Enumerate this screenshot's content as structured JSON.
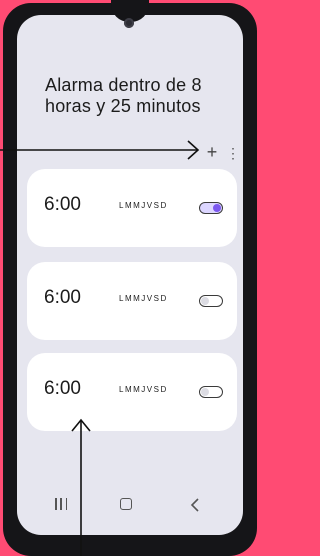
{
  "header": {
    "title": "Alarma dentro de 8 horas y 25 minutos"
  },
  "toolbar": {
    "add_icon": "plus-icon",
    "more_icon": "more-vert-icon",
    "add_glyph": "+",
    "more_glyph": "⋮"
  },
  "alarms": [
    {
      "time": "6:00",
      "days": "LMMJVSD",
      "enabled": true
    },
    {
      "time": "6:00",
      "days": "LMMJVSD",
      "enabled": false
    },
    {
      "time": "6:00",
      "days": "LMMJVSD",
      "enabled": false
    }
  ],
  "nav": {
    "recents_icon": "recents-icon",
    "home_icon": "home-icon",
    "back_icon": "back-icon"
  },
  "colors": {
    "background": "#ff4b73",
    "accent": "#7b57ef",
    "screen": "#e6e6ef",
    "card": "#ffffff"
  }
}
